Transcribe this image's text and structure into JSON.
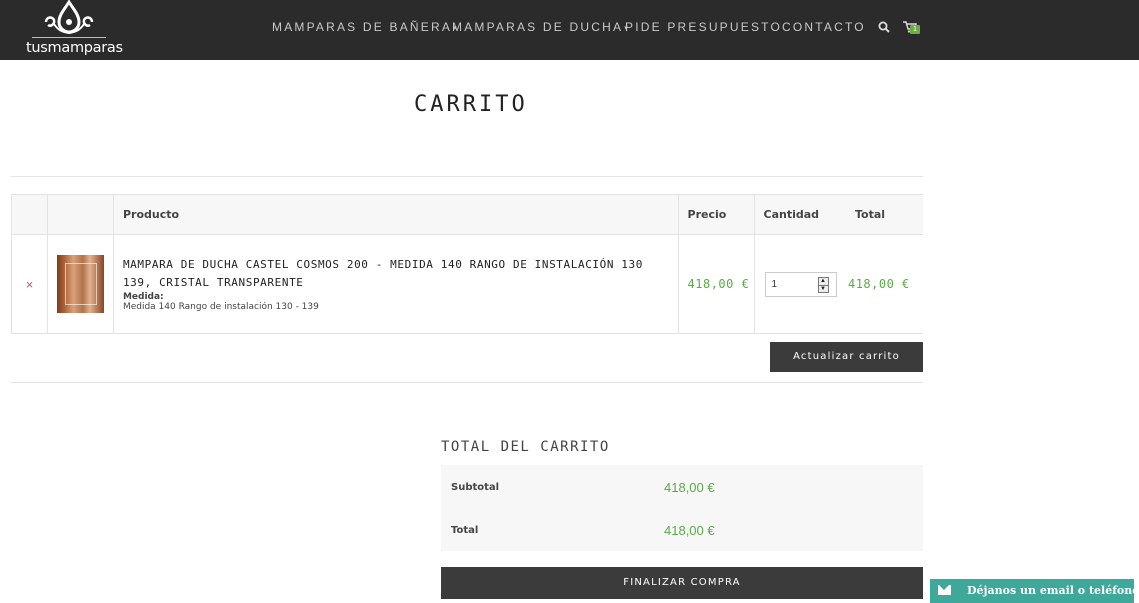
{
  "header": {
    "brand": "tusmamparas",
    "nav": [
      {
        "label": "MAMPARAS DE BAÑERA",
        "has_dropdown": true
      },
      {
        "label": "MAMPARAS DE DUCHA",
        "has_dropdown": true
      },
      {
        "label": "PIDE PRESUPUESTO",
        "has_dropdown": false
      },
      {
        "label": "CONTACTO",
        "has_dropdown": false
      }
    ],
    "search_icon": "search-icon",
    "cart_icon": "cart-icon",
    "cart_count": "1"
  },
  "page": {
    "title": "CARRITO"
  },
  "cart": {
    "columns": {
      "product": "Producto",
      "price": "Precio",
      "quantity": "Cantidad",
      "total": "Total"
    },
    "items": [
      {
        "remove": "×",
        "name": "MAMPARA DE DUCHA CASTEL COSMOS 200 - MEDIDA 140 RANGO DE INSTALACIÓN 130 139, CRISTAL TRANSPARENTE",
        "meta_label": "Medida:",
        "meta_value": "Medida 140 Rango de instalación 130 - 139",
        "price": "418,00 €",
        "quantity": "1",
        "total": "418,00 €"
      }
    ],
    "update_button": "Actualizar carrito"
  },
  "totals": {
    "title": "TOTAL DEL CARRITO",
    "subtotal_label": "Subtotal",
    "subtotal_value": "418,00 €",
    "total_label": "Total",
    "total_value": "418,00 €",
    "checkout_button": "FINALIZAR COMPRA"
  },
  "chat_widget": {
    "label": "Déjanos un email o teléfono",
    "icon": "envelope-icon"
  },
  "colors": {
    "header_bg": "#2b2b2b",
    "price_green": "#5aab46",
    "button_dark": "#3b3b3b",
    "remove_red": "#d9534f",
    "chat_teal": "#3ea99a"
  }
}
